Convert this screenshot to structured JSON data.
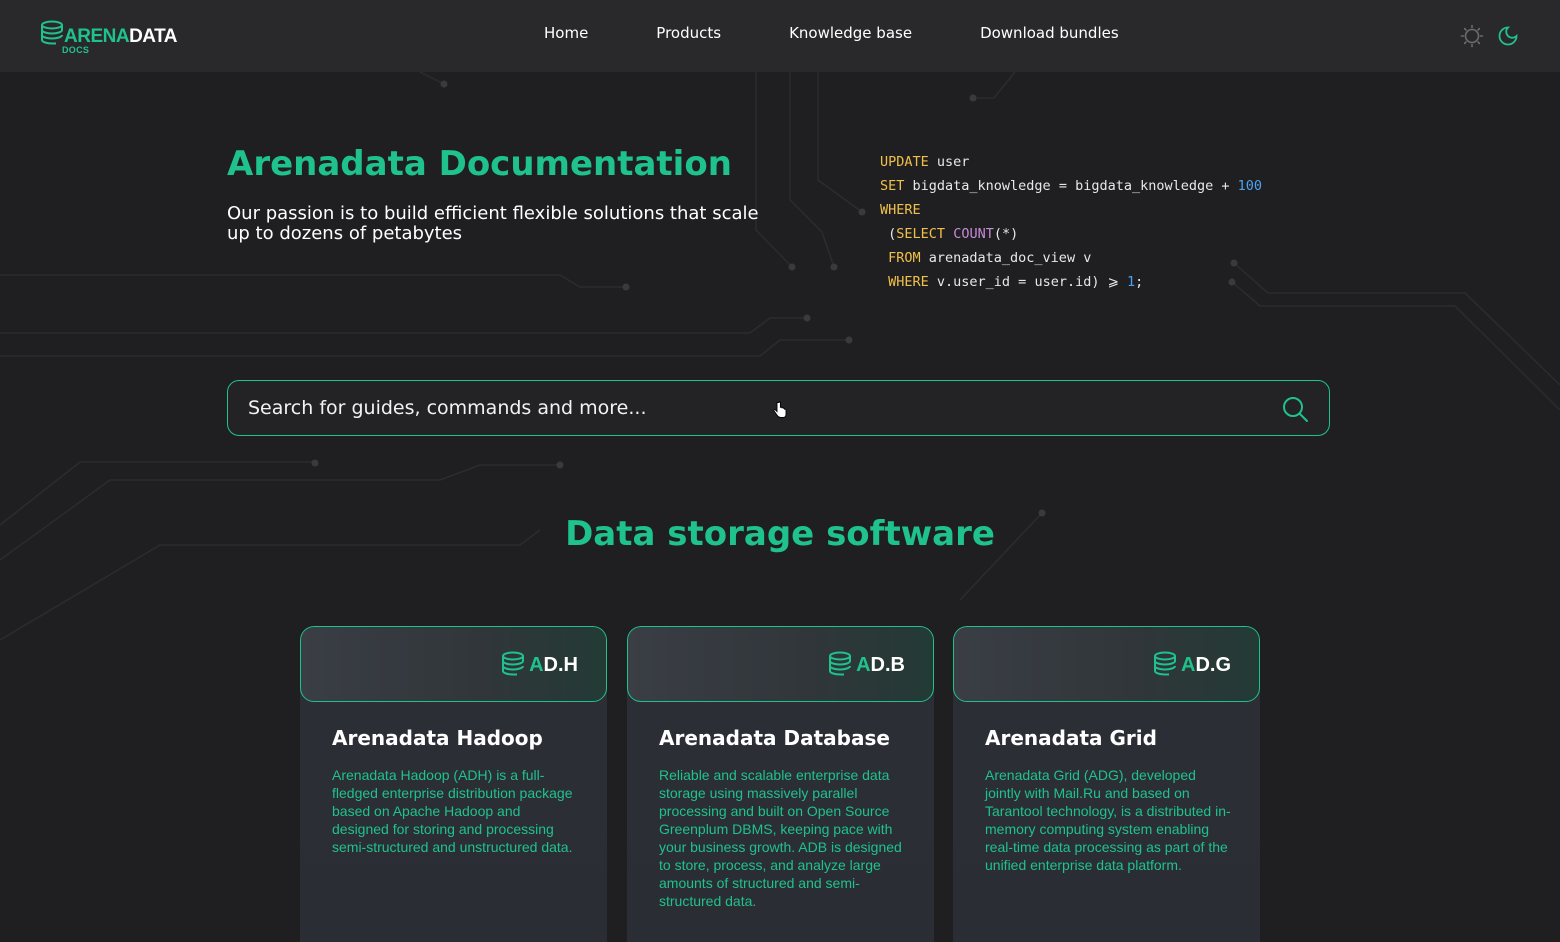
{
  "header": {
    "logo": {
      "brand_a": "ARENA",
      "brand_b": "DATA",
      "sub": "DOCS"
    },
    "nav": [
      "Home",
      "Products",
      "Knowledge base",
      "Download bundles"
    ],
    "theme_light_icon": "sun-icon",
    "theme_dark_icon": "moon-icon"
  },
  "hero": {
    "title": "Arenadata Documentation",
    "subtitle": "Our passion is to build efficient flexible solutions that scale up to dozens of petabytes"
  },
  "code": {
    "lines": [
      [
        {
          "t": "UPDATE",
          "c": "kw"
        },
        {
          "t": " user",
          "c": ""
        }
      ],
      [
        {
          "t": "SET",
          "c": "kw"
        },
        {
          "t": " bigdata_knowledge = bigdata_knowledge + ",
          "c": ""
        },
        {
          "t": "100",
          "c": "num"
        }
      ],
      [
        {
          "t": "WHERE",
          "c": "kw"
        }
      ],
      [
        {
          "t": " (",
          "c": ""
        },
        {
          "t": "SELECT",
          "c": "kw"
        },
        {
          "t": " ",
          "c": ""
        },
        {
          "t": "COUNT",
          "c": "fn"
        },
        {
          "t": "(*)",
          "c": ""
        }
      ],
      [
        {
          "t": " FROM",
          "c": "kw"
        },
        {
          "t": " arenadata_doc_view v",
          "c": ""
        }
      ],
      [
        {
          "t": " WHERE",
          "c": "kw"
        },
        {
          "t": " v.user_id = user.id) ⩾ ",
          "c": ""
        },
        {
          "t": "1",
          "c": "num"
        },
        {
          "t": ";",
          "c": ""
        }
      ]
    ]
  },
  "search": {
    "placeholder": "Search for guides, commands and more..."
  },
  "section": {
    "title": "Data storage software"
  },
  "cards": [
    {
      "badge_a": "A",
      "badge_rest": "D.H",
      "title": "Arenadata Hadoop",
      "description": "Arenadata Hadoop (ADH) is a full-fledged enterprise distribution package based on Apache Hadoop and designed for storing and processing semi-structured and unstructured data."
    },
    {
      "badge_a": "A",
      "badge_rest": "D.B",
      "title": "Arenadata Database",
      "description": "Reliable and scalable enterprise data storage using massively parallel processing and built on Open Source Greenplum DBMS, keeping pace with your business growth. ADB is designed to store, process, and analyze large amounts of structured and semi-structured data."
    },
    {
      "badge_a": "A",
      "badge_rest": "D.G",
      "title": "Arenadata Grid",
      "description": "Arenadata Grid (ADG), developed jointly with Mail.Ru and based on Tarantool technology, is a distributed in-memory computing system enabling real-time data processing as part of the unified enterprise data platform."
    }
  ],
  "colors": {
    "accent": "#1fc28d",
    "background": "#1f1f21",
    "header": "#29292c",
    "code_keyword": "#f0c04a",
    "code_function": "#c58ad8",
    "code_number": "#4aa3f0"
  }
}
